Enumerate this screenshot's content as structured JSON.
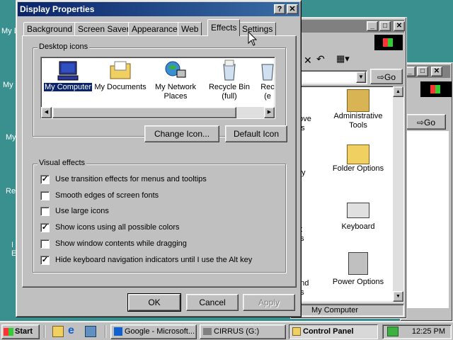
{
  "desktop": {
    "labels": [
      "My D",
      "My",
      "My",
      "Re",
      "I",
      "E"
    ]
  },
  "control_panel": {
    "address_go": "Go",
    "items": [
      {
        "label": "nove\nms"
      },
      {
        "label": "Administrative\nTools"
      },
      {
        "label": "y"
      },
      {
        "label": "Folder Options"
      },
      {
        "label": "et\nns"
      },
      {
        "label": "Keyboard"
      },
      {
        "label": "and\nns"
      },
      {
        "label": "Power Options"
      }
    ],
    "status": "My Computer"
  },
  "back_window": {
    "address_go": "Go"
  },
  "dialog": {
    "title": "Display Properties",
    "help_btn": "?",
    "close_btn": "✕",
    "tabs": [
      "Background",
      "Screen Saver",
      "Appearance",
      "Web",
      "Effects",
      "Settings"
    ],
    "desktop_icons_label": "Desktop icons",
    "icons": [
      {
        "label": "My Computer"
      },
      {
        "label": "My Documents"
      },
      {
        "label": "My Network\nPlaces"
      },
      {
        "label": "Recycle Bin\n(full)"
      },
      {
        "label": "Rec\n(e"
      }
    ],
    "change_icon_btn": "Change Icon...",
    "default_icon_btn": "Default Icon",
    "visual_effects_label": "Visual effects",
    "options": [
      {
        "label": "Use transition effects for menus and tooltips",
        "checked": true
      },
      {
        "label": "Smooth edges of screen fonts",
        "checked": false
      },
      {
        "label": "Use large icons",
        "checked": false
      },
      {
        "label": "Show icons using all possible colors",
        "checked": true
      },
      {
        "label": "Show window contents while dragging",
        "checked": false
      },
      {
        "label": "Hide keyboard navigation indicators until I use the Alt key",
        "checked": true
      }
    ],
    "ok_btn": "OK",
    "cancel_btn": "Cancel",
    "apply_btn": "Apply"
  },
  "taskbar": {
    "start": "Start",
    "tasks": [
      "Google - Microsoft...",
      "CIRRUS (G:)",
      "Control Panel"
    ],
    "clock": "12:25 PM"
  }
}
